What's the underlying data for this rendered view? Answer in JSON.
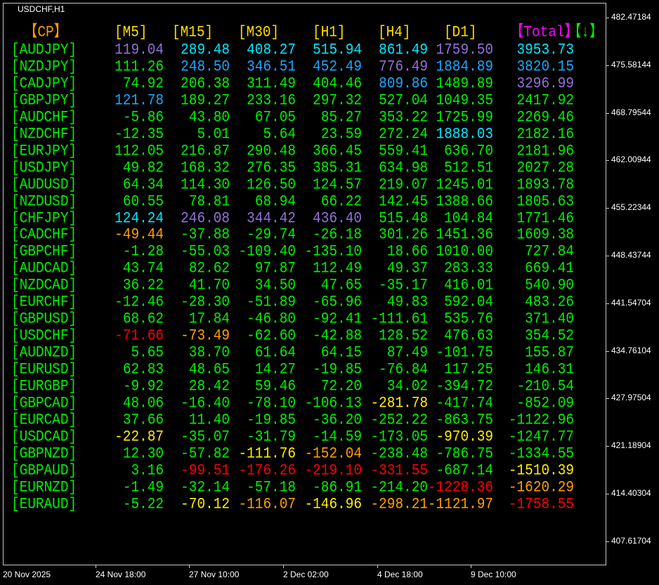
{
  "window": {
    "title": "USDCHF,H1"
  },
  "colors": {
    "G": "#00f000",
    "C": "#00e8ff",
    "B": "#1aa6ff",
    "P": "#9370db",
    "Y": "#ffee00",
    "O": "#ffa000",
    "R": "#ff0000",
    "header": "#ffdd00",
    "cp": "#ff9900",
    "total": "#ff00ff",
    "arrow": "#00f000"
  },
  "header": {
    "cp": "【CP】",
    "columns": [
      "[M5]",
      "[M15]",
      "[M30]",
      "[H1]",
      "[H4]",
      "[D1]"
    ],
    "total": "【Total】",
    "sort": "【↓】"
  },
  "rows": [
    {
      "pair": "[AUDJPY]",
      "values": [
        "119.04",
        "289.48",
        "408.27",
        "515.94",
        "861.49",
        "1759.50",
        "3953.73"
      ],
      "colors": "PCCCCPC"
    },
    {
      "pair": "[NZDJPY]",
      "values": [
        "111.26",
        "248.50",
        "346.51",
        "452.49",
        "776.49",
        "1884.89",
        "3820.15"
      ],
      "colors": "GBBBPBB"
    },
    {
      "pair": "[CADJPY]",
      "values": [
        "74.92",
        "206.38",
        "311.49",
        "404.46",
        "809.86",
        "1489.89",
        "3296.99"
      ],
      "colors": "GGGGBGP"
    },
    {
      "pair": "[GBPJPY]",
      "values": [
        "121.78",
        "189.27",
        "233.16",
        "297.32",
        "527.04",
        "1049.35",
        "2417.92"
      ],
      "colors": "BGGGGGG"
    },
    {
      "pair": "[AUDCHF]",
      "values": [
        "-5.86",
        "43.80",
        "67.05",
        "85.27",
        "353.22",
        "1725.99",
        "2269.46"
      ],
      "colors": "GGGGGGG"
    },
    {
      "pair": "[NZDCHF]",
      "values": [
        "-12.35",
        "5.01",
        "5.64",
        "23.59",
        "272.24",
        "1888.03",
        "2182.16"
      ],
      "colors": "GGGGGCG"
    },
    {
      "pair": "[EURJPY]",
      "values": [
        "112.05",
        "216.87",
        "290.48",
        "366.45",
        "559.41",
        "636.70",
        "2181.96"
      ],
      "colors": "GGGGGGG"
    },
    {
      "pair": "[USDJPY]",
      "values": [
        "49.82",
        "168.32",
        "276.35",
        "385.31",
        "634.98",
        "512.51",
        "2027.28"
      ],
      "colors": "GGGGGGG"
    },
    {
      "pair": "[AUDUSD]",
      "values": [
        "64.34",
        "114.30",
        "126.50",
        "124.57",
        "219.07",
        "1245.01",
        "1893.78"
      ],
      "colors": "GGGGGGG"
    },
    {
      "pair": "[NZDUSD]",
      "values": [
        "60.55",
        "78.81",
        "68.94",
        "66.22",
        "142.45",
        "1388.66",
        "1805.63"
      ],
      "colors": "GGGGGGG"
    },
    {
      "pair": "[CHFJPY]",
      "values": [
        "124.24",
        "246.08",
        "344.42",
        "436.40",
        "515.48",
        "104.84",
        "1771.46"
      ],
      "colors": "CPPPGGG"
    },
    {
      "pair": "[CADCHF]",
      "values": [
        "-49.44",
        "-37.88",
        "-29.74",
        "-26.18",
        "301.26",
        "1451.36",
        "1609.38"
      ],
      "colors": "OGGGGGG"
    },
    {
      "pair": "[GBPCHF]",
      "values": [
        "-1.28",
        "-55.03",
        "-109.40",
        "-135.10",
        "18.66",
        "1010.00",
        "727.84"
      ],
      "colors": "GGGGGGG"
    },
    {
      "pair": "[AUDCAD]",
      "values": [
        "43.74",
        "82.62",
        "97.87",
        "112.49",
        "49.37",
        "283.33",
        "669.41"
      ],
      "colors": "GGGGGGG"
    },
    {
      "pair": "[NZDCAD]",
      "values": [
        "36.22",
        "41.70",
        "34.50",
        "47.65",
        "-35.17",
        "416.01",
        "540.90"
      ],
      "colors": "GGGGGGG"
    },
    {
      "pair": "[EURCHF]",
      "values": [
        "-12.46",
        "-28.30",
        "-51.89",
        "-65.96",
        "49.83",
        "592.04",
        "483.26"
      ],
      "colors": "GGGGGGG"
    },
    {
      "pair": "[GBPUSD]",
      "values": [
        "68.62",
        "17.84",
        "-46.80",
        "-92.41",
        "-111.61",
        "535.76",
        "371.40"
      ],
      "colors": "GGGGGGG"
    },
    {
      "pair": "[USDCHF]",
      "values": [
        "-71.66",
        "-73.49",
        "-62.60",
        "-42.88",
        "128.52",
        "476.63",
        "354.52"
      ],
      "colors": "ROGGGGG"
    },
    {
      "pair": "[AUDNZD]",
      "values": [
        "5.65",
        "38.70",
        "61.64",
        "64.15",
        "87.49",
        "-101.75",
        "155.87"
      ],
      "colors": "GGGGGGG"
    },
    {
      "pair": "[EURUSD]",
      "values": [
        "62.83",
        "48.65",
        "14.27",
        "-19.85",
        "-76.84",
        "117.25",
        "146.31"
      ],
      "colors": "GGGGGGG"
    },
    {
      "pair": "[EURGBP]",
      "values": [
        "-9.92",
        "28.42",
        "59.46",
        "72.20",
        "34.02",
        "-394.72",
        "-210.54"
      ],
      "colors": "GGGGGGG"
    },
    {
      "pair": "[GBPCAD]",
      "values": [
        "48.06",
        "-16.40",
        "-78.10",
        "-106.13",
        "-281.78",
        "-417.74",
        "-852.09"
      ],
      "colors": "GGGGYGG"
    },
    {
      "pair": "[EURCAD]",
      "values": [
        "37.66",
        "11.40",
        "-19.85",
        "-36.20",
        "-252.22",
        "-863.75",
        "-1122.96"
      ],
      "colors": "GGGGGGG"
    },
    {
      "pair": "[USDCAD]",
      "values": [
        "-22.87",
        "-35.07",
        "-31.79",
        "-14.59",
        "-173.05",
        "-970.39",
        "-1247.77"
      ],
      "colors": "YGGGGYG"
    },
    {
      "pair": "[GBPNZD]",
      "values": [
        "12.30",
        "-57.82",
        "-111.76",
        "-152.04",
        "-238.48",
        "-786.75",
        "-1334.55"
      ],
      "colors": "GGYOGGG"
    },
    {
      "pair": "[GBPAUD]",
      "values": [
        "3.16",
        "-99.51",
        "-176.26",
        "-219.10",
        "-331.55",
        "-687.14",
        "-1510.39"
      ],
      "colors": "GRRRRGY"
    },
    {
      "pair": "[EURNZD]",
      "values": [
        "-1.49",
        "-32.14",
        "-57.18",
        "-86.91",
        "-214.20",
        "-1228.36",
        "-1620.29"
      ],
      "colors": "GGGGGRO"
    },
    {
      "pair": "[EURAUD]",
      "values": [
        "-5.22",
        "-70.12",
        "-116.07",
        "-146.96",
        "-298.21",
        "-1121.97",
        "-1758.55"
      ],
      "colors": "GYOYOOR"
    }
  ],
  "price_axis": [
    "482.47184",
    "475.58144",
    "468.79544",
    "462.00944",
    "455.22344",
    "448.43744",
    "441.54704",
    "434.76104",
    "427.97504",
    "421.18904",
    "414.40304",
    "407.61704"
  ],
  "time_axis": [
    "20 Nov 2025",
    "24 Nov 18:00",
    "27 Nov 10:00",
    "2 Dec 02:00",
    "4 Dec 18:00",
    "9 Dec 10:00"
  ]
}
